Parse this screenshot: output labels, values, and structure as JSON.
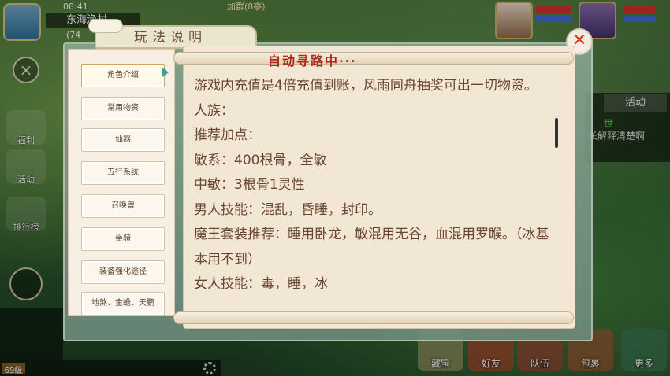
{
  "status": {
    "time": "08:41",
    "location": "东海渔村",
    "coord": "(74",
    "top_center": "加群(8亭)"
  },
  "left_icons": [
    "福利",
    "活动",
    "排行榜"
  ],
  "right_panel": {
    "activity_tab": "活动",
    "world_label": "世",
    "message": "长解释清楚啊"
  },
  "bottom_buttons": [
    "藏宝",
    "好友",
    "队伍",
    "包裹",
    "更多"
  ],
  "bottom_bar": {
    "level_badge": "69级"
  },
  "dialog": {
    "title": "玩法说明",
    "close_symbol": "✕",
    "scroll_header": "自动寻路中···",
    "menu_items": [
      "角色介绍",
      "常用物资",
      "仙器",
      "五行系统",
      "召唤兽",
      "坐骑",
      "装备强化途径",
      "地煞、金蟾、天鹏"
    ],
    "active_index": 0,
    "content_lines": [
      "游戏内充值是4倍充值到账，风雨同舟抽奖可出一切物资。",
      "人族：",
      "推荐加点：",
      "敏系：400根骨，全敏",
      "中敏：3根骨1灵性",
      "男人技能：混乱，昏睡，封印。",
      "魔王套装推荐：睡用卧龙，敏混用无谷，血混用罗睺。（冰基本用不到）",
      "女人技能：毒，睡，冰"
    ]
  },
  "colors": {
    "title_text": "#6d4e3a",
    "header_red": "#b02a1c",
    "content_text": "#6a4530",
    "close_red": "#d33b2b"
  }
}
